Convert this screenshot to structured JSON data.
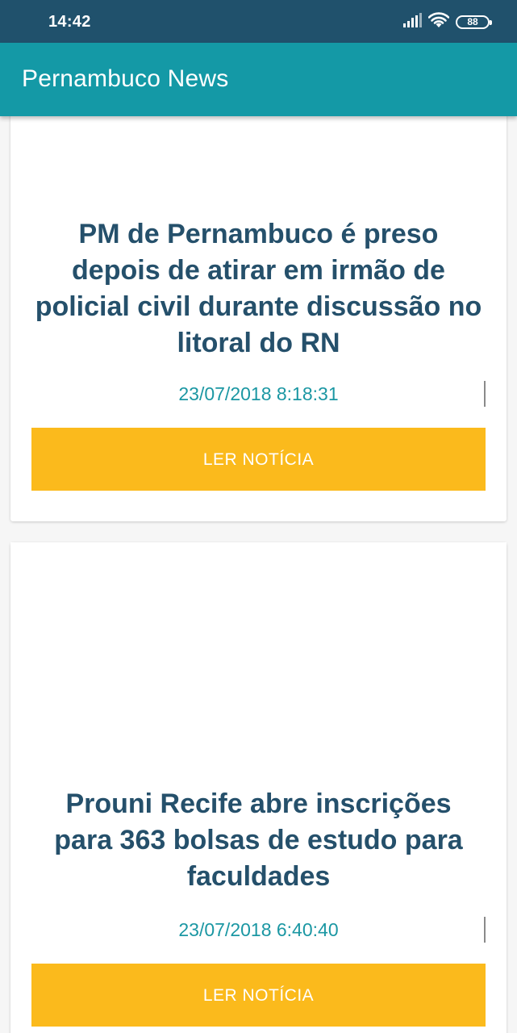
{
  "status_bar": {
    "time": "14:42",
    "battery_level": "88",
    "icons": [
      "signal-icon",
      "wifi-icon",
      "battery-icon"
    ]
  },
  "app_bar": {
    "title": "Pernambuco News"
  },
  "news": [
    {
      "title": "PM de Pernambuco é preso depois de atirar em irmão de policial civil durante discussão no litoral do RN",
      "date": "23/07/2018 8:18:31",
      "button_label": "LER NOTÍCIA"
    },
    {
      "title": "Prouni Recife abre inscrições para 363 bolsas de estudo para faculdades",
      "date": "23/07/2018 6:40:40",
      "button_label": "LER NOTÍCIA"
    }
  ],
  "colors": {
    "status_bar": "#20516c",
    "app_bar": "#1499a6",
    "headline": "#25506b",
    "timestamp": "#1b97a3",
    "button": "#fbba1c"
  }
}
